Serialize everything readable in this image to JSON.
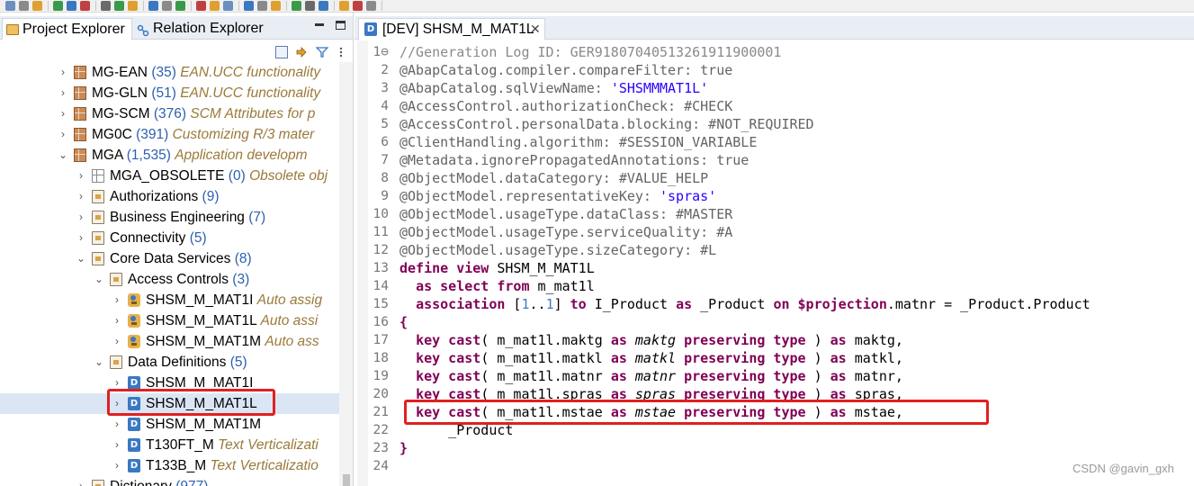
{
  "left_panel": {
    "tabs": [
      {
        "label": "Project Explorer",
        "active": true
      },
      {
        "label": "Relation Explorer",
        "active": false
      }
    ],
    "tree": [
      {
        "level": 0,
        "expand": "›",
        "icon": "package",
        "name": "MG-EAN",
        "count": "(35)",
        "desc": "EAN.UCC functionality"
      },
      {
        "level": 0,
        "expand": "›",
        "icon": "package",
        "name": "MG-GLN",
        "count": "(51)",
        "desc": "EAN.UCC functionality"
      },
      {
        "level": 0,
        "expand": "›",
        "icon": "package",
        "name": "MG-SCM",
        "count": "(376)",
        "desc": "SCM Attributes for p"
      },
      {
        "level": 0,
        "expand": "›",
        "icon": "package",
        "name": "MG0C",
        "count": "(391)",
        "desc": "Customizing R/3 mater"
      },
      {
        "level": 0,
        "expand": "⌄",
        "icon": "package",
        "name": "MGA",
        "count": "(1,535)",
        "desc": "Application developm"
      },
      {
        "level": 1,
        "expand": "›",
        "icon": "package-grey",
        "name": "MGA_OBSOLETE",
        "count": "(0)",
        "desc": "Obsolete obj"
      },
      {
        "level": 1,
        "expand": "›",
        "icon": "folder",
        "name": "Authorizations",
        "count": "(9)",
        "desc": ""
      },
      {
        "level": 1,
        "expand": "›",
        "icon": "folder",
        "name": "Business Engineering",
        "count": "(7)",
        "desc": ""
      },
      {
        "level": 1,
        "expand": "›",
        "icon": "folder",
        "name": "Connectivity",
        "count": "(5)",
        "desc": ""
      },
      {
        "level": 1,
        "expand": "⌄",
        "icon": "folder",
        "name": "Core Data Services",
        "count": "(8)",
        "desc": ""
      },
      {
        "level": 2,
        "expand": "⌄",
        "icon": "folder",
        "name": "Access Controls",
        "count": "(3)",
        "desc": ""
      },
      {
        "level": 3,
        "expand": "›",
        "icon": "access",
        "name": "SHSM_M_MAT1I",
        "count": "",
        "desc": "Auto assig"
      },
      {
        "level": 3,
        "expand": "›",
        "icon": "access",
        "name": "SHSM_M_MAT1L",
        "count": "",
        "desc": "Auto assi"
      },
      {
        "level": 3,
        "expand": "›",
        "icon": "access",
        "name": "SHSM_M_MAT1M",
        "count": "",
        "desc": "Auto ass"
      },
      {
        "level": 2,
        "expand": "⌄",
        "icon": "folder",
        "name": "Data Definitions",
        "count": "(5)",
        "desc": ""
      },
      {
        "level": 3,
        "expand": "›",
        "icon": "ddl",
        "name": "SHSM_M_MAT1I",
        "count": "",
        "desc": ""
      },
      {
        "level": 3,
        "expand": "›",
        "icon": "ddl",
        "name": "SHSM_M_MAT1L",
        "count": "",
        "desc": "",
        "selected": true
      },
      {
        "level": 3,
        "expand": "›",
        "icon": "ddl",
        "name": "SHSM_M_MAT1M",
        "count": "",
        "desc": ""
      },
      {
        "level": 3,
        "expand": "›",
        "icon": "ddl",
        "name": "T130FT_M",
        "count": "",
        "desc": "Text Verticalizati"
      },
      {
        "level": 3,
        "expand": "›",
        "icon": "ddl",
        "name": "T133B_M",
        "count": "",
        "desc": "Text Verticalizatio"
      },
      {
        "level": 1,
        "expand": "›",
        "icon": "folder",
        "name": "Dictionary",
        "count": "(977)",
        "desc": ""
      }
    ]
  },
  "editor": {
    "tab_label": "[DEV] SHSM_M_MAT1L",
    "tab_icon": "D",
    "lines": [
      {
        "n": "1⊖",
        "segs": [
          [
            "cmt",
            "//Generation Log ID: GER91807040513261911900001"
          ]
        ]
      },
      {
        "n": "2",
        "segs": [
          [
            "ann",
            "@AbapCatalog.compiler.compareFilter: true"
          ]
        ]
      },
      {
        "n": "3",
        "segs": [
          [
            "ann",
            "@AbapCatalog.sqlViewName: "
          ],
          [
            "str",
            "'SHSMMMAT1L'"
          ]
        ]
      },
      {
        "n": "4",
        "segs": [
          [
            "ann",
            "@AccessControl.authorizationCheck: #CHECK"
          ]
        ]
      },
      {
        "n": "5",
        "segs": [
          [
            "ann",
            "@AccessControl.personalData.blocking: #NOT_REQUIRED"
          ]
        ]
      },
      {
        "n": "6",
        "segs": [
          [
            "ann",
            "@ClientHandling.algorithm: #SESSION_VARIABLE"
          ]
        ]
      },
      {
        "n": "7",
        "segs": [
          [
            "ann",
            "@Metadata.ignorePropagatedAnnotations: true"
          ]
        ]
      },
      {
        "n": "8",
        "segs": [
          [
            "ann",
            "@ObjectModel.dataCategory: #VALUE_HELP"
          ]
        ]
      },
      {
        "n": "9",
        "segs": [
          [
            "ann",
            "@ObjectModel.representativeKey: "
          ],
          [
            "str",
            "'spras'"
          ]
        ]
      },
      {
        "n": "10",
        "segs": [
          [
            "ann",
            "@ObjectModel.usageType.dataClass: #MASTER"
          ]
        ]
      },
      {
        "n": "11",
        "segs": [
          [
            "ann",
            "@ObjectModel.usageType.serviceQuality: #A"
          ]
        ]
      },
      {
        "n": "12",
        "segs": [
          [
            "ann",
            "@ObjectModel.usageType.sizeCategory: #L"
          ]
        ]
      },
      {
        "n": "13",
        "segs": [
          [
            "kw",
            "define view"
          ],
          [
            "",
            " SHSM_M_MAT1L"
          ]
        ]
      },
      {
        "n": "14",
        "segs": [
          [
            "",
            "  "
          ],
          [
            "kw",
            "as select from"
          ],
          [
            "",
            " m_mat1l"
          ]
        ]
      },
      {
        "n": "15",
        "segs": [
          [
            "",
            "  "
          ],
          [
            "kw",
            "association"
          ],
          [
            "",
            " ["
          ],
          [
            "num",
            "1"
          ],
          [
            "",
            ".."
          ],
          [
            "num",
            "1"
          ],
          [
            "",
            "] "
          ],
          [
            "kw",
            "to"
          ],
          [
            "",
            " I_Product "
          ],
          [
            "kw",
            "as"
          ],
          [
            "",
            " _Product "
          ],
          [
            "kw",
            "on"
          ],
          [
            "",
            " "
          ],
          [
            "kw",
            "$projection"
          ],
          [
            "",
            ".matnr = _Product.Product"
          ]
        ]
      },
      {
        "n": "16",
        "segs": [
          [
            "kw",
            "{"
          ]
        ]
      },
      {
        "n": "17",
        "segs": [
          [
            "",
            "  "
          ],
          [
            "kw",
            "key cast"
          ],
          [
            "",
            "( m_mat1l.maktg "
          ],
          [
            "kw",
            "as"
          ],
          [
            "",
            " "
          ],
          [
            "itl",
            "maktg"
          ],
          [
            "",
            " "
          ],
          [
            "kw",
            "preserving type"
          ],
          [
            "",
            " ) "
          ],
          [
            "kw",
            "as"
          ],
          [
            "",
            " maktg,"
          ]
        ]
      },
      {
        "n": "18",
        "segs": [
          [
            "",
            "  "
          ],
          [
            "kw",
            "key cast"
          ],
          [
            "",
            "( m_mat1l.matkl "
          ],
          [
            "kw",
            "as"
          ],
          [
            "",
            " "
          ],
          [
            "itl",
            "matkl"
          ],
          [
            "",
            " "
          ],
          [
            "kw",
            "preserving type"
          ],
          [
            "",
            " ) "
          ],
          [
            "kw",
            "as"
          ],
          [
            "",
            " matkl,"
          ]
        ]
      },
      {
        "n": "19",
        "segs": [
          [
            "",
            "  "
          ],
          [
            "kw",
            "key cast"
          ],
          [
            "",
            "( m_mat1l.matnr "
          ],
          [
            "kw",
            "as"
          ],
          [
            "",
            " "
          ],
          [
            "itl",
            "matnr"
          ],
          [
            "",
            " "
          ],
          [
            "kw",
            "preserving type"
          ],
          [
            "",
            " ) "
          ],
          [
            "kw",
            "as"
          ],
          [
            "",
            " matnr,"
          ]
        ]
      },
      {
        "n": "20",
        "segs": [
          [
            "",
            "  "
          ],
          [
            "kw",
            "key cast"
          ],
          [
            "",
            "( m_mat1l.spras "
          ],
          [
            "kw",
            "as"
          ],
          [
            "",
            " "
          ],
          [
            "itl",
            "spras"
          ],
          [
            "",
            " "
          ],
          [
            "kw",
            "preserving type"
          ],
          [
            "",
            " ) "
          ],
          [
            "kw",
            "as"
          ],
          [
            "",
            " spras,"
          ]
        ]
      },
      {
        "n": "21",
        "segs": [
          [
            "",
            "  "
          ],
          [
            "kw",
            "key cast"
          ],
          [
            "",
            "( m_mat1l.mstae "
          ],
          [
            "kw",
            "as"
          ],
          [
            "",
            " "
          ],
          [
            "itl",
            "mstae"
          ],
          [
            "",
            " "
          ],
          [
            "kw",
            "preserving type"
          ],
          [
            "",
            " ) "
          ],
          [
            "kw",
            "as"
          ],
          [
            "",
            " mstae,"
          ]
        ]
      },
      {
        "n": "22",
        "segs": [
          [
            "",
            "      _Product"
          ]
        ]
      },
      {
        "n": "23",
        "segs": [
          [
            "kw",
            "}"
          ]
        ]
      },
      {
        "n": "24",
        "segs": [
          [
            "",
            ""
          ]
        ]
      }
    ]
  },
  "watermark": "CSDN @gavin_gxh",
  "colors": {
    "keyword": "#7f0055",
    "annotation": "#646464",
    "string": "#2a00ff",
    "comment": "#8a8a8a",
    "count": "#2d5fb0",
    "description": "#9a7a3a",
    "highlight_box": "#e02020"
  }
}
